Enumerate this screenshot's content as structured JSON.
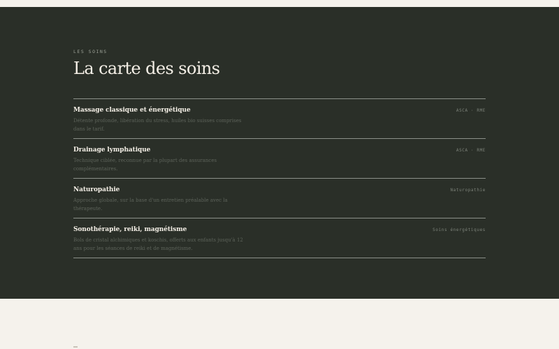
{
  "section": {
    "eyebrow": "LES SOINS",
    "title": "La carte des soins"
  },
  "treatments": [
    {
      "name": "Massage classique et énergétique",
      "description": "Détente profonde, libération du stress, huiles bio suisses comprises dans le tarif.",
      "tag": "ASCA · RME"
    },
    {
      "name": "Drainage lymphatique",
      "description": "Technique ciblée, reconnue par la plupart des assurances complémentaires.",
      "tag": "ASCA · RME"
    },
    {
      "name": "Naturopathie",
      "description": "Approche globale, sur la base d'un entretien préalable avec la thérapeute.",
      "tag": "Naturopathie"
    },
    {
      "name": "Sonothérapie, reiki, magnétisme",
      "description": "Bols de cristal alchimiques et koschis, offerts aux enfants jusqu'à 12 ans pour les séances de reiki et de magnétisme.",
      "tag": "Soins énergétiques"
    }
  ],
  "colors": {
    "section_bg": "#2a2f28",
    "page_bg": "#f5f2ec",
    "heading": "#f4efe6",
    "muted": "#5d635a",
    "divider": "#8c918a"
  }
}
